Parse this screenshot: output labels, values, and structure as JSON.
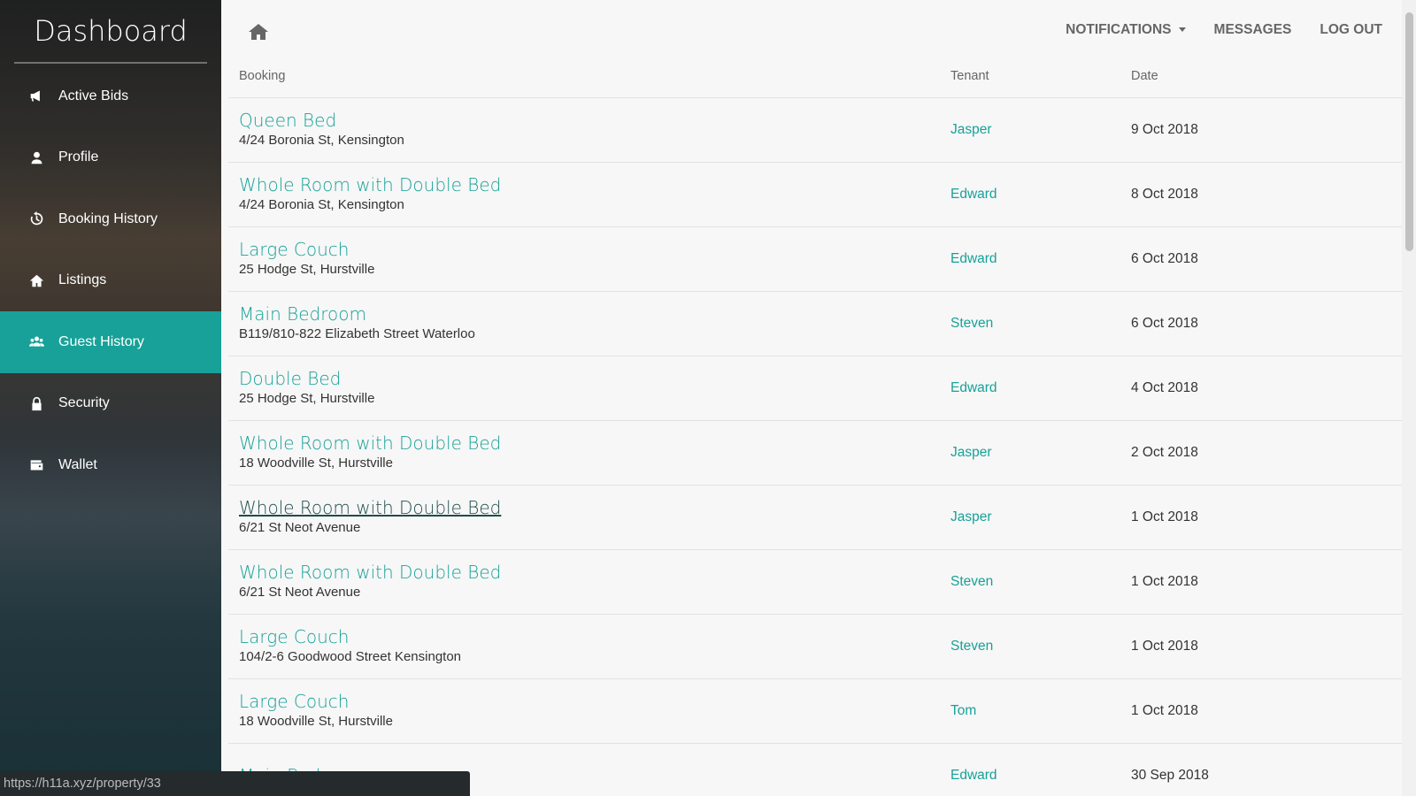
{
  "sidebar": {
    "brand": "Dashboard",
    "items": [
      {
        "label": "Active Bids",
        "icon": "megaphone-icon"
      },
      {
        "label": "Profile",
        "icon": "user-icon"
      },
      {
        "label": "Booking History",
        "icon": "history-icon"
      },
      {
        "label": "Listings",
        "icon": "home-icon"
      },
      {
        "label": "Guest History",
        "icon": "users-icon",
        "active": true
      },
      {
        "label": "Security",
        "icon": "lock-icon"
      },
      {
        "label": "Wallet",
        "icon": "wallet-icon"
      }
    ]
  },
  "topbar": {
    "home_icon": "home-icon",
    "notifications": "NOTIFICATIONS",
    "messages": "MESSAGES",
    "logout": "LOG OUT"
  },
  "table": {
    "headers": {
      "booking": "Booking",
      "tenant": "Tenant",
      "date": "Date"
    },
    "rows": [
      {
        "title": "Queen Bed",
        "address": "4/24 Boronia St, Kensington",
        "tenant": "Jasper",
        "date": "9 Oct 2018"
      },
      {
        "title": "Whole Room with Double Bed",
        "address": "4/24 Boronia St, Kensington",
        "tenant": "Edward",
        "date": "8 Oct 2018"
      },
      {
        "title": "Large Couch",
        "address": "25 Hodge St, Hurstville",
        "tenant": "Edward",
        "date": "6 Oct 2018"
      },
      {
        "title": "Main Bedroom",
        "address": "B119/810-822 Elizabeth Street Waterloo",
        "tenant": "Steven",
        "date": "6 Oct 2018"
      },
      {
        "title": "Double Bed",
        "address": "25 Hodge St, Hurstville",
        "tenant": "Edward",
        "date": "4 Oct 2018"
      },
      {
        "title": "Whole Room with Double Bed",
        "address": "18 Woodville St, Hurstville",
        "tenant": "Jasper",
        "date": "2 Oct 2018"
      },
      {
        "title": "Whole Room with Double Bed",
        "address": "6/21 St Neot Avenue",
        "tenant": "Jasper",
        "date": "1 Oct 2018",
        "hovered": true
      },
      {
        "title": "Whole Room with Double Bed",
        "address": "6/21 St Neot Avenue",
        "tenant": "Steven",
        "date": "1 Oct 2018"
      },
      {
        "title": "Large Couch",
        "address": "104/2-6 Goodwood Street Kensington",
        "tenant": "Steven",
        "date": "1 Oct 2018"
      },
      {
        "title": "Large Couch",
        "address": "18 Woodville St, Hurstville",
        "tenant": "Tom",
        "date": "1 Oct 2018"
      },
      {
        "title": "Main Bedroom",
        "address": "",
        "tenant": "Edward",
        "date": "30 Sep 2018"
      }
    ]
  },
  "statusbar": {
    "url": "https://h11a.xyz/property/33"
  },
  "colors": {
    "accent": "#17a198",
    "active_bg": "#17a198"
  }
}
